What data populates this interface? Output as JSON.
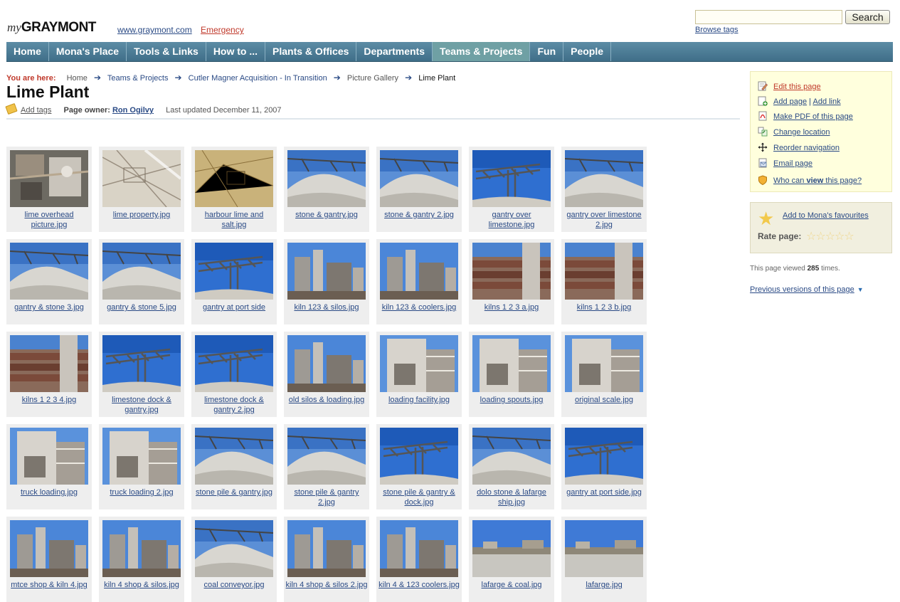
{
  "header": {
    "logo_my": "my",
    "logo_brand": "GRAYMONT",
    "site_link": "www.graymont.com",
    "emergency_link": "Emergency",
    "search_button": "Search",
    "browse_tags": "Browse tags"
  },
  "nav": [
    "Home",
    "Mona's Place",
    "Tools & Links",
    "How to ...",
    "Plants & Offices",
    "Departments",
    "Teams & Projects",
    "Fun",
    "People"
  ],
  "nav_active": "Teams & Projects",
  "breadcrumb": {
    "label": "You are here:",
    "items": [
      "Home",
      "Teams & Projects",
      "Cutler Magner Acquisition - In Transition",
      "Picture Gallery",
      "Lime Plant"
    ]
  },
  "page": {
    "title": "Lime Plant",
    "add_tags": "Add tags",
    "owner_label": "Page owner:",
    "owner_name": "Ron Ogilvy",
    "last_updated": "Last updated December 11, 2007"
  },
  "gallery": [
    {
      "caption": "lime overhead picture.jpg",
      "scene": "aerial"
    },
    {
      "caption": "lime property.jpg",
      "scene": "map"
    },
    {
      "caption": "harbour lime and salt.jpg",
      "scene": "map2"
    },
    {
      "caption": "stone & gantry.jpg",
      "scene": "pile"
    },
    {
      "caption": "stone & gantry 2.jpg",
      "scene": "pile"
    },
    {
      "caption": "gantry over limestone.jpg",
      "scene": "gantry"
    },
    {
      "caption": "gantry over limestone 2.jpg",
      "scene": "pile"
    },
    {
      "caption": "gantry & stone 3.jpg",
      "scene": "pile"
    },
    {
      "caption": "gantry & stone 5.jpg",
      "scene": "pile"
    },
    {
      "caption": "gantry at port side",
      "scene": "gantry"
    },
    {
      "caption": "kiln 123 & silos.jpg",
      "scene": "plant"
    },
    {
      "caption": "kiln 123 & coolers.jpg",
      "scene": "plant"
    },
    {
      "caption": "kilns 1 2 3 a.jpg",
      "scene": "pipes"
    },
    {
      "caption": "kilns 1 2 3 b.jpg",
      "scene": "pipes"
    },
    {
      "caption": "kilns 1 2 3 4.jpg",
      "scene": "pipes"
    },
    {
      "caption": "limestone dock & gantry.jpg",
      "scene": "gantry"
    },
    {
      "caption": "limestone dock & gantry 2.jpg",
      "scene": "gantry"
    },
    {
      "caption": "old silos & loading.jpg",
      "scene": "plant"
    },
    {
      "caption": "loading facility.jpg",
      "scene": "silo"
    },
    {
      "caption": "loading spouts.jpg",
      "scene": "silo"
    },
    {
      "caption": "original scale.jpg",
      "scene": "silo"
    },
    {
      "caption": "truck loading.jpg",
      "scene": "silo"
    },
    {
      "caption": "truck loading 2.jpg",
      "scene": "silo"
    },
    {
      "caption": "stone pile & gantry.jpg",
      "scene": "pile"
    },
    {
      "caption": "stone pile & gantry 2.jpg",
      "scene": "pile"
    },
    {
      "caption": "stone pile & gantry & dock.jpg",
      "scene": "gantry"
    },
    {
      "caption": "dolo stone & lafarge ship.jpg",
      "scene": "pile"
    },
    {
      "caption": "gantry at port side.jpg",
      "scene": "gantry"
    },
    {
      "caption": "mtce shop & kiln 4.jpg",
      "scene": "plant"
    },
    {
      "caption": "kiln 4 shop & silos.jpg",
      "scene": "plant"
    },
    {
      "caption": "coal conveyor.jpg",
      "scene": "pile"
    },
    {
      "caption": "kiln 4 shop & silos 2.jpg",
      "scene": "plant"
    },
    {
      "caption": "kiln 4 & 123 coolers.jpg",
      "scene": "plant"
    },
    {
      "caption": "lafarge & coal.jpg",
      "scene": "road"
    },
    {
      "caption": "lafarge.jpg",
      "scene": "road"
    }
  ],
  "sidebar": {
    "actions": [
      {
        "label": "Edit this page",
        "icon": "edit-page-icon",
        "color": "#c0392b"
      },
      {
        "label": "Add page",
        "label2": "Add link",
        "icon": "add-page-icon"
      },
      {
        "label": "Make PDF of this page",
        "icon": "pdf-icon"
      },
      {
        "label": "Change location",
        "icon": "move-icon"
      },
      {
        "label": "Reorder navigation",
        "icon": "reorder-icon"
      },
      {
        "label": "Email page",
        "icon": "email-icon"
      },
      {
        "label": "Who can view this page?",
        "icon": "shield-icon"
      }
    ],
    "favourites": "Add to Mona's favourites",
    "rate_label": "Rate page:",
    "viewed_prefix": "This page viewed",
    "viewed_count": "285",
    "viewed_suffix": "times.",
    "previous_versions": "Previous versions of this page"
  }
}
